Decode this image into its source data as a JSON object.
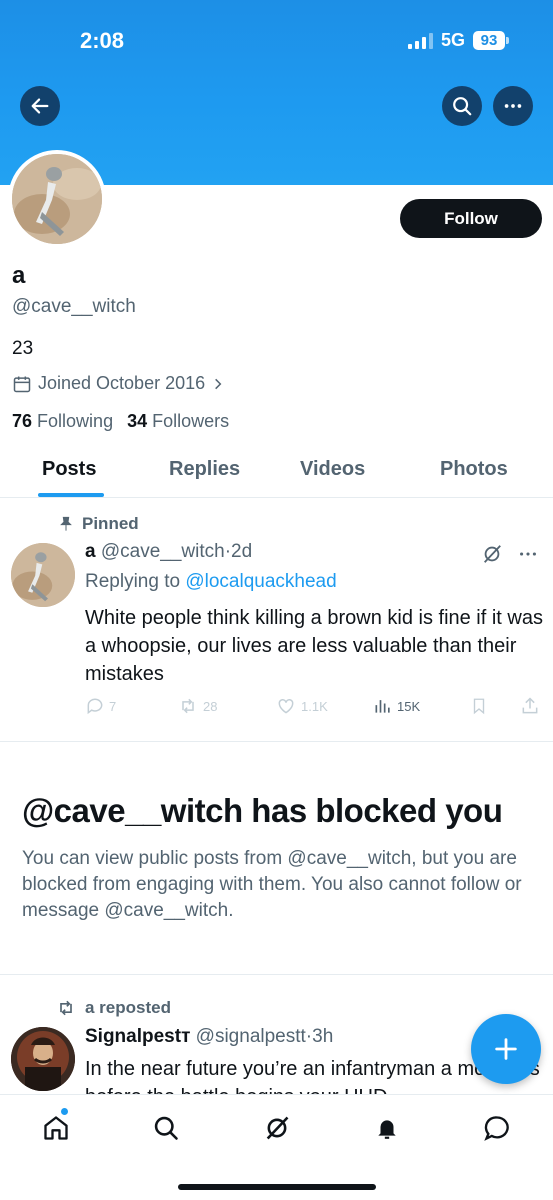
{
  "status_bar": {
    "time": "2:08",
    "network": "5G",
    "battery": "93"
  },
  "profile": {
    "name": "a",
    "handle": "@cave__witch",
    "bio": "23",
    "joined": "Joined October 2016",
    "following_count": "76",
    "following_label": "Following",
    "followers_count": "34",
    "followers_label": "Followers",
    "follow_label": "Follow"
  },
  "tabs": [
    "Posts",
    "Replies",
    "Videos",
    "Photos"
  ],
  "pinned_post": {
    "pinned_label": "Pinned",
    "author": "a",
    "handle": "@cave__witch",
    "time": "2d",
    "replying_prefix": "Replying to",
    "replying_to": "@localquackhead",
    "text": "White people think killing a brown kid is fine if it was a whoopsie, our lives are less valuable than their mistakes",
    "replies": "7",
    "reposts": "28",
    "likes": "1.1K",
    "views": "15K"
  },
  "blocked": {
    "title": "@cave__witch has blocked you",
    "message": "You can view public posts from @cave__witch, but you are blocked from engaging with them. You also cannot follow or message @cave__witch."
  },
  "repost": {
    "label": "a reposted",
    "author": "Signalpestт",
    "handle": "@signalpestt",
    "time": "3h",
    "text": "In the near future you’re an infantryman a moments before the battle begins your HUD"
  },
  "colors": {
    "accent": "#1d9bf0",
    "banner": "#1e9af0",
    "text": "#0f1419",
    "secondary": "#536471"
  }
}
